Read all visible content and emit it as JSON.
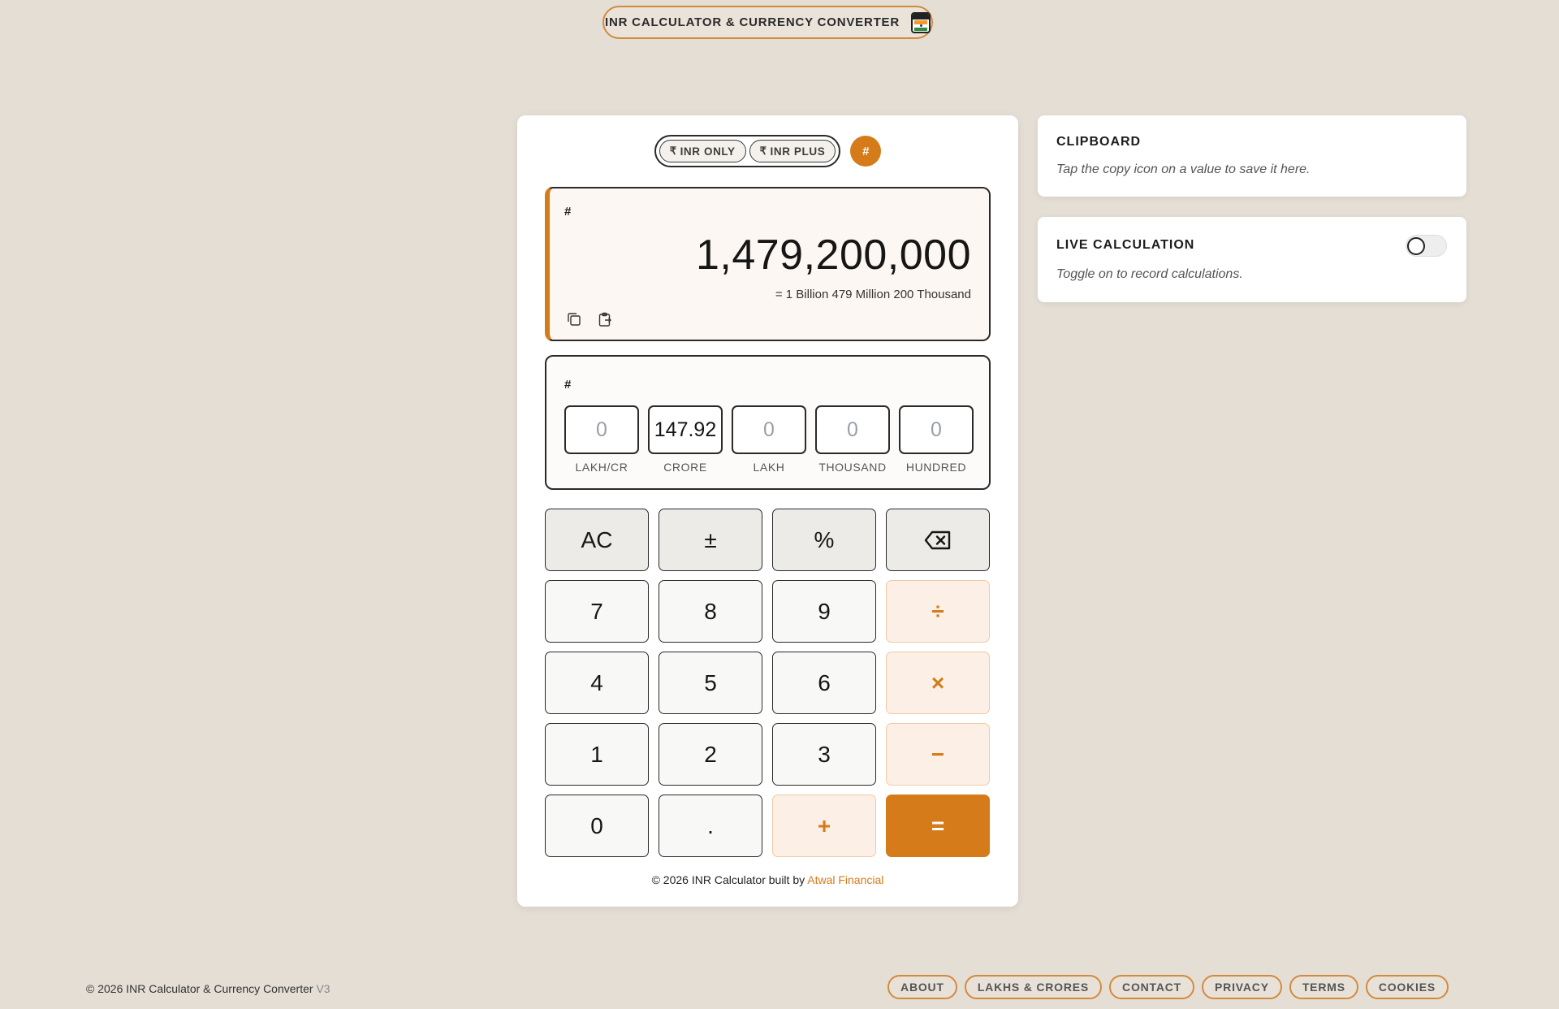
{
  "header": {
    "title": "INR CALCULATOR & CURRENCY CONVERTER",
    "flag_icon": "india-flag-calculator-icon"
  },
  "calculator": {
    "modes": [
      {
        "symbol": "₹",
        "label": "INR ONLY"
      },
      {
        "symbol": "₹",
        "label": "INR PLUS"
      }
    ],
    "hash_button": "#",
    "display": {
      "hash_label": "#",
      "value": "1,479,200,000",
      "words": "= 1 Billion 479 Million 200 Thousand",
      "icons": [
        "copy-icon",
        "clipboard-paste-icon"
      ]
    },
    "breakdown": {
      "hash_label": "#",
      "cells": [
        {
          "value": "0",
          "label": "LAKH/CR"
        },
        {
          "value": "147.92",
          "label": "CRORE"
        },
        {
          "value": "0",
          "label": "LAKH"
        },
        {
          "value": "0",
          "label": "THOUSAND"
        },
        {
          "value": "0",
          "label": "HUNDRED"
        }
      ]
    },
    "keys": {
      "ac": "AC",
      "plusminus": "±",
      "percent": "%",
      "k7": "7",
      "k8": "8",
      "k9": "9",
      "divide": "÷",
      "k4": "4",
      "k5": "5",
      "k6": "6",
      "multiply": "×",
      "k1": "1",
      "k2": "2",
      "k3": "3",
      "minus": "−",
      "k0": "0",
      "dot": ".",
      "plus": "+",
      "equals": "="
    },
    "credit": {
      "text": "© 2026 INR Calculator built by",
      "link": "Atwal Financial"
    }
  },
  "clipboard": {
    "title": "CLIPBOARD",
    "hint": "Tap the copy icon on a value to save it here."
  },
  "live": {
    "title": "LIVE CALCULATION",
    "hint": "Toggle on to record calculations.",
    "enabled": false
  },
  "footer": {
    "copyright": "© 2026 INR Calculator & Currency Converter",
    "version": "V3",
    "links": [
      "ABOUT",
      "LAKHS & CRORES",
      "CONTACT",
      "PRIVACY",
      "TERMS",
      "COOKIES"
    ]
  },
  "colors": {
    "accent": "#d57b1a",
    "background": "#e4ded5",
    "card": "#ffffff"
  }
}
